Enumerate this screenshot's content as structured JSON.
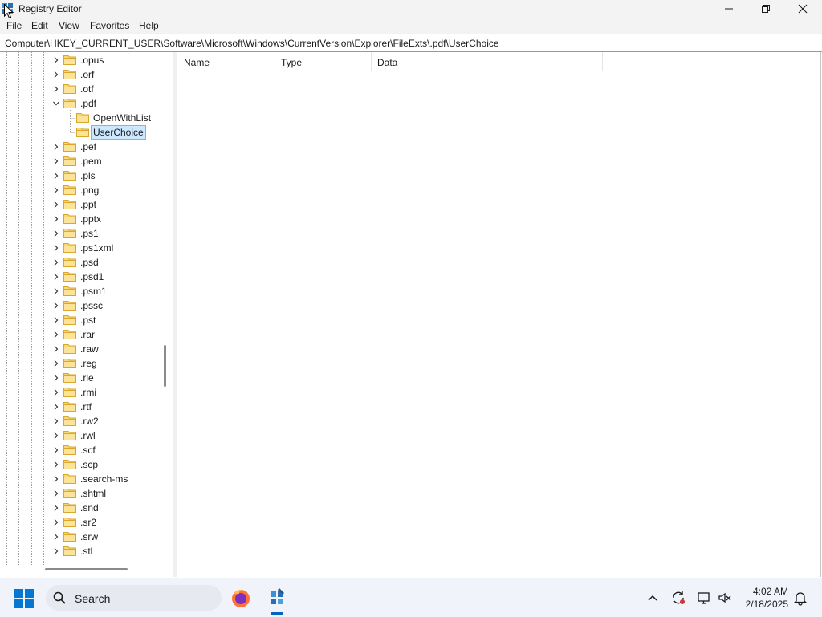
{
  "window": {
    "title": "Registry Editor"
  },
  "menu": [
    "File",
    "Edit",
    "View",
    "Favorites",
    "Help"
  ],
  "address": "Computer\\HKEY_CURRENT_USER\\Software\\Microsoft\\Windows\\CurrentVersion\\Explorer\\FileExts\\.pdf\\UserChoice",
  "tree": [
    {
      "label": ".opus",
      "level": 1,
      "expanded": false,
      "selected": false
    },
    {
      "label": ".orf",
      "level": 1,
      "expanded": false,
      "selected": false
    },
    {
      "label": ".otf",
      "level": 1,
      "expanded": false,
      "selected": false
    },
    {
      "label": ".pdf",
      "level": 1,
      "expanded": true,
      "selected": false
    },
    {
      "label": "OpenWithList",
      "level": 2,
      "expanded": null,
      "selected": false
    },
    {
      "label": "UserChoice",
      "level": 2,
      "expanded": null,
      "selected": true
    },
    {
      "label": ".pef",
      "level": 1,
      "expanded": false,
      "selected": false
    },
    {
      "label": ".pem",
      "level": 1,
      "expanded": false,
      "selected": false
    },
    {
      "label": ".pls",
      "level": 1,
      "expanded": false,
      "selected": false
    },
    {
      "label": ".png",
      "level": 1,
      "expanded": false,
      "selected": false
    },
    {
      "label": ".ppt",
      "level": 1,
      "expanded": false,
      "selected": false
    },
    {
      "label": ".pptx",
      "level": 1,
      "expanded": false,
      "selected": false
    },
    {
      "label": ".ps1",
      "level": 1,
      "expanded": false,
      "selected": false
    },
    {
      "label": ".ps1xml",
      "level": 1,
      "expanded": false,
      "selected": false
    },
    {
      "label": ".psd",
      "level": 1,
      "expanded": false,
      "selected": false
    },
    {
      "label": ".psd1",
      "level": 1,
      "expanded": false,
      "selected": false
    },
    {
      "label": ".psm1",
      "level": 1,
      "expanded": false,
      "selected": false
    },
    {
      "label": ".pssc",
      "level": 1,
      "expanded": false,
      "selected": false
    },
    {
      "label": ".pst",
      "level": 1,
      "expanded": false,
      "selected": false
    },
    {
      "label": ".rar",
      "level": 1,
      "expanded": false,
      "selected": false
    },
    {
      "label": ".raw",
      "level": 1,
      "expanded": false,
      "selected": false
    },
    {
      "label": ".reg",
      "level": 1,
      "expanded": false,
      "selected": false
    },
    {
      "label": ".rle",
      "level": 1,
      "expanded": false,
      "selected": false
    },
    {
      "label": ".rmi",
      "level": 1,
      "expanded": false,
      "selected": false
    },
    {
      "label": ".rtf",
      "level": 1,
      "expanded": false,
      "selected": false
    },
    {
      "label": ".rw2",
      "level": 1,
      "expanded": false,
      "selected": false
    },
    {
      "label": ".rwl",
      "level": 1,
      "expanded": false,
      "selected": false
    },
    {
      "label": ".scf",
      "level": 1,
      "expanded": false,
      "selected": false
    },
    {
      "label": ".scp",
      "level": 1,
      "expanded": false,
      "selected": false
    },
    {
      "label": ".search-ms",
      "level": 1,
      "expanded": false,
      "selected": false
    },
    {
      "label": ".shtml",
      "level": 1,
      "expanded": false,
      "selected": false
    },
    {
      "label": ".snd",
      "level": 1,
      "expanded": false,
      "selected": false
    },
    {
      "label": ".sr2",
      "level": 1,
      "expanded": false,
      "selected": false
    },
    {
      "label": ".srw",
      "level": 1,
      "expanded": false,
      "selected": false
    },
    {
      "label": ".stl",
      "level": 1,
      "expanded": false,
      "selected": false
    }
  ],
  "list": {
    "columns": [
      "Name",
      "Type",
      "Data"
    ],
    "rows": []
  },
  "taskbar": {
    "search_label": "Search",
    "apps": [
      "firefox-icon",
      "regedit-icon"
    ],
    "active_app": "regedit-icon",
    "tray_icons": [
      "chevron-up-icon",
      "sync-icon",
      "network-icon",
      "volume-muted-icon",
      "notification-bell-icon"
    ],
    "time": "4:02 AM",
    "date": "2/18/2025"
  },
  "colors": {
    "selection_bg": "#cce8ff",
    "selection_border": "#7eb4ea",
    "folder_yellow": "#f8d775",
    "accent": "#0067c0"
  }
}
